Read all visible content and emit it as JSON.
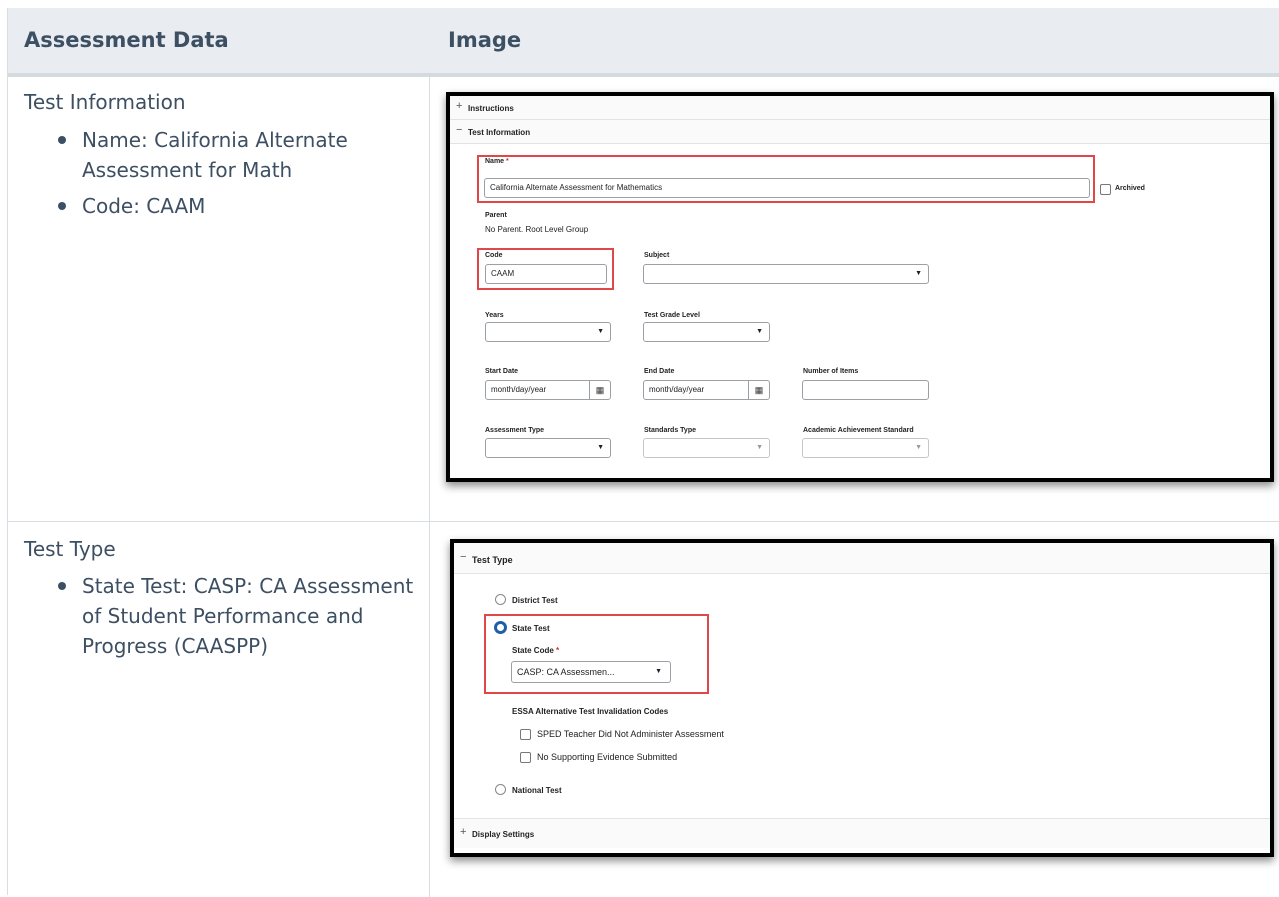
{
  "table": {
    "headers": [
      "Assessment Data",
      "Image"
    ],
    "rows": [
      {
        "title": "Test Information",
        "bullets": [
          "Name: California Alternate Assessment for Math",
          "Code: CAAM"
        ]
      },
      {
        "title": "Test Type",
        "bullets": [
          "State Test: CASP: CA Assessment of Student Performance and Progress (CAASPP)"
        ]
      }
    ]
  },
  "screenshot1": {
    "instructions_label": "Instructions",
    "test_info_label": "Test Information",
    "name_label": "Name",
    "required_mark": "*",
    "name_value": "California Alternate Assessment for Mathematics",
    "archived_label": "Archived",
    "parent_label": "Parent",
    "parent_value": "No Parent. Root Level Group",
    "code_label": "Code",
    "code_value": "CAAM",
    "subject_label": "Subject",
    "years_label": "Years",
    "grade_label": "Test Grade Level",
    "start_label": "Start Date",
    "start_placeholder": "month/day/year",
    "end_label": "End Date",
    "end_placeholder": "month/day/year",
    "items_label": "Number of Items",
    "assessment_type_label": "Assessment Type",
    "standards_type_label": "Standards Type",
    "academic_label": "Academic Achievement Standard"
  },
  "screenshot2": {
    "test_type_label": "Test Type",
    "district_label": "District Test",
    "state_label": "State Test",
    "state_code_label": "State Code",
    "required_mark": "*",
    "state_code_value": "CASP: CA Assessmen...",
    "essa_label": "ESSA Alternative Test Invalidation Codes",
    "essa_options": [
      "SPED Teacher Did Not Administer Assessment",
      "No Supporting Evidence Submitted"
    ],
    "national_label": "National Test",
    "display_label": "Display Settings"
  },
  "colors": {
    "highlight": "#e04848",
    "radio_selected": "#1e5fa8",
    "header_bg": "#e9edf1",
    "text": "#3d4f63"
  },
  "icons": {
    "collapse": "minus-icon",
    "expand": "plus-icon",
    "dropdown": "caret-down-icon",
    "calendar": "calendar-icon"
  }
}
